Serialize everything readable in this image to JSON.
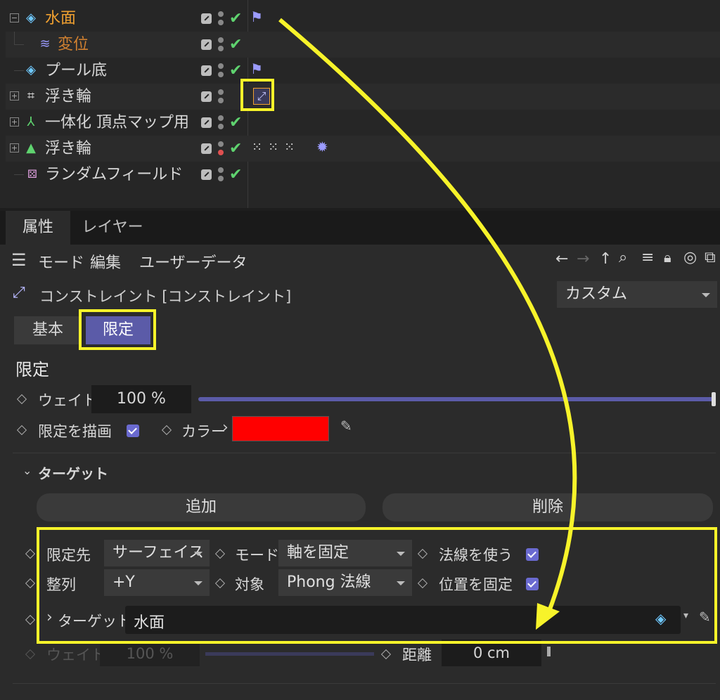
{
  "object_manager": {
    "rows": [
      {
        "name": "水面",
        "color": "#f0a030",
        "icon": "plane-icon"
      },
      {
        "name": "変位",
        "color": "#d08030",
        "icon": "displacer-icon"
      },
      {
        "name": "プール底",
        "color": "#d8d8d8",
        "icon": "plane-icon"
      },
      {
        "name": "浮き輪",
        "color": "#d8d8d8",
        "icon": "spline-icon"
      },
      {
        "name": "一体化 頂点マップ用",
        "color": "#d8d8d8",
        "icon": "connect-icon"
      },
      {
        "name": "浮き輪",
        "color": "#d8d8d8",
        "icon": "polygon-icon"
      },
      {
        "name": "ランダムフィールド",
        "color": "#d8d8d8",
        "icon": "random-field-icon"
      }
    ]
  },
  "tabs": {
    "attributes": "属性",
    "layer": "レイヤー"
  },
  "menubar": {
    "mode": "モード",
    "edit": "編集",
    "user_data": "ユーザーデータ"
  },
  "header": {
    "object_label": "コンストレイント [コンストレイント]",
    "preset": "カスタム"
  },
  "subtabs": {
    "basic": "基本",
    "limit": "限定"
  },
  "section": {
    "title": "限定"
  },
  "weight": {
    "label": "ウェイト",
    "value": "100 %",
    "fraction": 1.0
  },
  "draw_limit": {
    "label": "限定を描画",
    "checked": true
  },
  "color": {
    "label": "カラー",
    "swatch": "#ff0000"
  },
  "target_group": {
    "title": "ターゲット",
    "add": "追加",
    "delete": "削除"
  },
  "target_fields": {
    "limit_to_label": "限定先",
    "limit_to_value": "サーフェイス",
    "mode_label": "モード",
    "mode_value": "軸を固定",
    "use_normal_label": "法線を使う",
    "align_label": "整列",
    "align_value": "+Y",
    "target_label": "対象",
    "target_value": "Phong 法線",
    "fix_position_label": "位置を固定",
    "target_object_label": "ターゲット",
    "target_object_value": "水面"
  },
  "bottom_row": {
    "weight_label": "ウェイト",
    "weight_value": "100 %",
    "distance_label": "距離",
    "distance_value": "0 cm"
  },
  "colors": {
    "highlight": "#f7f32a",
    "accent": "#5b5ba8",
    "check": "#5fd36f"
  }
}
